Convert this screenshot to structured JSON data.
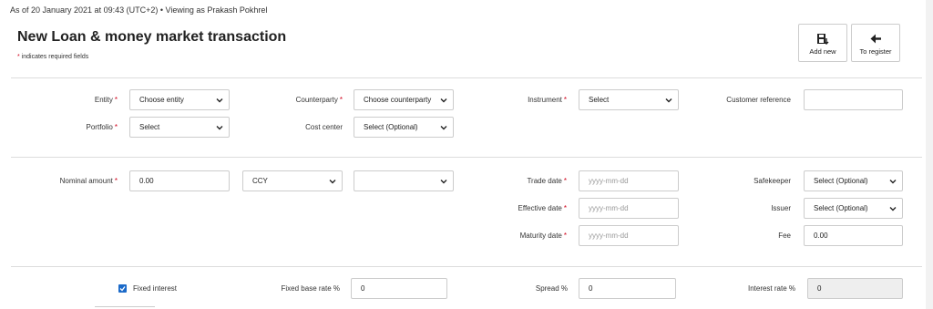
{
  "header": {
    "status": "As of 20 January 2021 at 09:43 (UTC+2) • Viewing as Prakash Pokhrel",
    "title": "New Loan & money market transaction",
    "required_note_star": "*",
    "required_note": " indicates required fields"
  },
  "toolbar": {
    "add_new": "Add new",
    "to_register": "To register"
  },
  "required_marker": "*",
  "section1": {
    "entity_label": "Entity",
    "entity_value": "Choose entity",
    "counterparty_label": "Counterparty",
    "counterparty_value": "Choose counterparty",
    "instrument_label": "Instrument",
    "instrument_value": "Select",
    "customer_reference_label": "Customer reference",
    "customer_reference_value": "",
    "portfolio_label": "Portfolio",
    "portfolio_value": "Select",
    "cost_center_label": "Cost center",
    "cost_center_value": "Select (Optional)"
  },
  "section2": {
    "nominal_amount_label": "Nominal amount",
    "nominal_amount_value": "0.00",
    "ccy_value": "CCY",
    "extra_select_value": "",
    "trade_date_label": "Trade date",
    "trade_date_placeholder": "yyyy-mm-dd",
    "effective_date_label": "Effective date",
    "effective_date_placeholder": "yyyy-mm-dd",
    "maturity_date_label": "Maturity date",
    "maturity_date_placeholder": "yyyy-mm-dd",
    "safekeeper_label": "Safekeeper",
    "safekeeper_value": "Select (Optional)",
    "issuer_label": "Issuer",
    "issuer_value": "Select (Optional)",
    "fee_label": "Fee",
    "fee_value": "0.00"
  },
  "section3": {
    "fixed_interest_label": "Fixed interest",
    "fixed_interest_checked": true,
    "fixed_base_rate_label": "Fixed base rate %",
    "fixed_base_rate_value": "0",
    "spread_label": "Spread %",
    "spread_value": "0",
    "interest_rate_label": "Interest rate %",
    "interest_rate_value": "0"
  },
  "colors": {
    "required": "#d0021b",
    "checkbox": "#1b6ac9"
  }
}
